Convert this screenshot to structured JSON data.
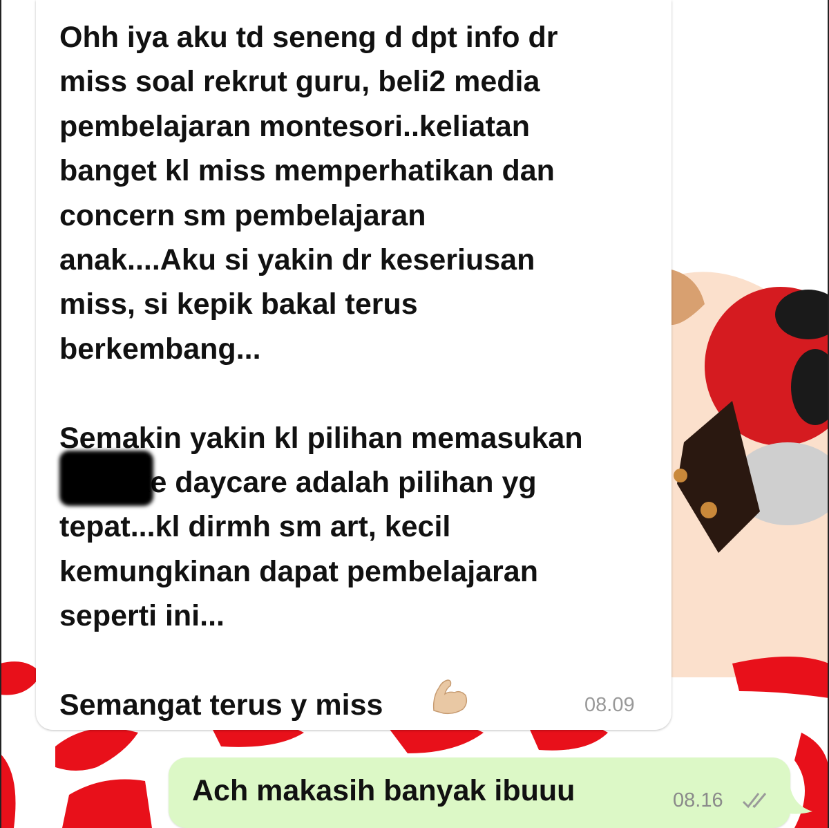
{
  "conversation": {
    "incoming_message": {
      "text": "Ohh iya aku td seneng d dpt info dr\nmiss soal rekrut guru, beli2 media\npembelajaran montesori..keliatan\nbanget kl miss memperhatikan dan\nconcern sm pembelajaran\nanak....Aku si yakin dr keseriusan\nmiss, si kepik bakal terus\nberkembang...\n\nSemakin yakin kl pilihan memasukan\n         ke daycare adalah pilihan yg\ntepat...kl dirmh sm art, kecil\nkemungkinan dapat pembelajaran\nseperti ini...\n\nSemangat terus y miss",
      "emoji_icon": "flexed-biceps-icon",
      "time": "08.09"
    },
    "outgoing_message": {
      "text": "Ach makasih banyak ibuuu",
      "time": "08.16",
      "status_icon": "double-check-icon"
    }
  },
  "colors": {
    "outgoing_bubble": "#dcf8c6",
    "incoming_bubble": "#ffffff",
    "wallpaper_red": "#e8101a"
  }
}
